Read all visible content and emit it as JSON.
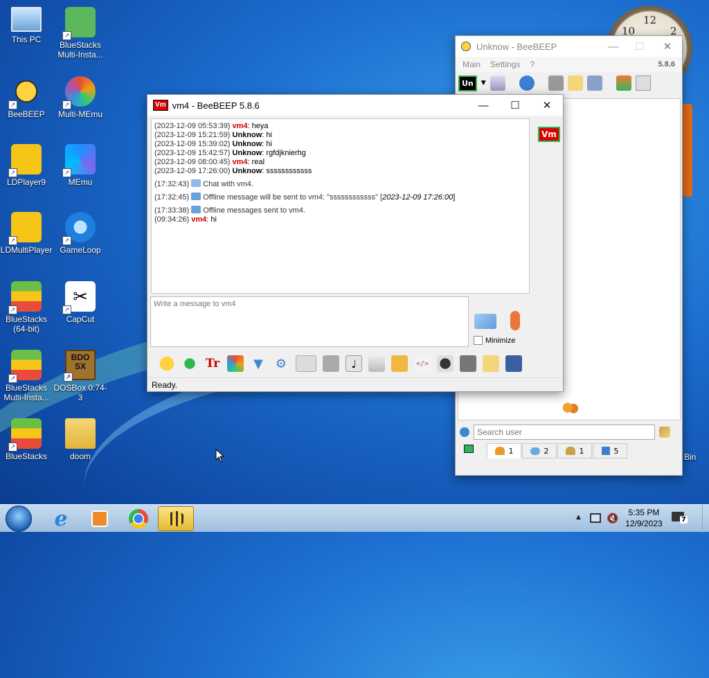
{
  "desktop": {
    "icons": [
      {
        "label": "This PC"
      },
      {
        "label": "BlueStacks Multi-Insta..."
      },
      {
        "label": "BeeBEEP"
      },
      {
        "label": "Multi-MEmu"
      },
      {
        "label": "LDPlayer9"
      },
      {
        "label": "MEmu"
      },
      {
        "label": "LDMultiPlayer"
      },
      {
        "label": "GameLoop"
      },
      {
        "label": "BlueStacks (64-bit)"
      },
      {
        "label": "CapCut"
      },
      {
        "label": "BlueStacks Multi-Insta..."
      },
      {
        "label": "DOSBox 0.74-3"
      },
      {
        "label": "BlueStacks"
      },
      {
        "label": "doom"
      }
    ],
    "recycle_label": "Bin",
    "clock_numbers": [
      "10",
      "12",
      "2"
    ]
  },
  "main_window": {
    "title": "Unknow - BeeBEEP",
    "menu": [
      "Main",
      "Settings",
      "?"
    ],
    "version": "5.8.6",
    "user_badge": "Un",
    "search_placeholder": "Search user",
    "tabs": [
      {
        "icon": "users-icon",
        "count": "1"
      },
      {
        "icon": "chat-icon",
        "count": "2"
      },
      {
        "icon": "group-icon",
        "count": "1"
      },
      {
        "icon": "share-icon",
        "count": "5"
      }
    ]
  },
  "chat_window": {
    "title": "vm4 - BeeBEEP 5.8.6",
    "badge": "Vm",
    "log": [
      {
        "ts": "(2023-12-09 05:53:39)",
        "user": "vm4",
        "kind": "vm",
        "text": ": heya"
      },
      {
        "ts": "(2023-12-09 15:21:59)",
        "user": "Unknow",
        "kind": "un",
        "text": ": hi"
      },
      {
        "ts": "(2023-12-09 15:39:02)",
        "user": "Unknow",
        "kind": "un",
        "text": ": hi"
      },
      {
        "ts": "(2023-12-09 15:42:57)",
        "user": "Unknow",
        "kind": "un",
        "text": ": rgfdjknierhg"
      },
      {
        "ts": "(2023-12-09 08:00:45)",
        "user": "vm4",
        "kind": "vm",
        "text": ": real"
      },
      {
        "ts": "(2023-12-09 17:26:00)",
        "user": "Unknow",
        "kind": "un",
        "text": ": ssssssssssss"
      }
    ],
    "system_log": [
      {
        "ts": "(17:32:43)",
        "text": "Chat with vm4."
      },
      {
        "ts": "(17:32:45)",
        "text": "Offline message will be sent to vm4: \"ssssssssssss\" [",
        "italic": "2023-12-09 17:26:00",
        "tail": "]"
      },
      {
        "ts": "(17:33:38)",
        "text": "Offline messages sent to vm4."
      }
    ],
    "last": {
      "ts": "(09:34:26)",
      "user": "vm4",
      "text": ": hi"
    },
    "input_placeholder": "Write a message to vm4",
    "minimize_label": "Minimize",
    "status": "Ready."
  },
  "taskbar": {
    "time": "5:35 PM",
    "date": "12/9/2023",
    "notifications": "7"
  }
}
